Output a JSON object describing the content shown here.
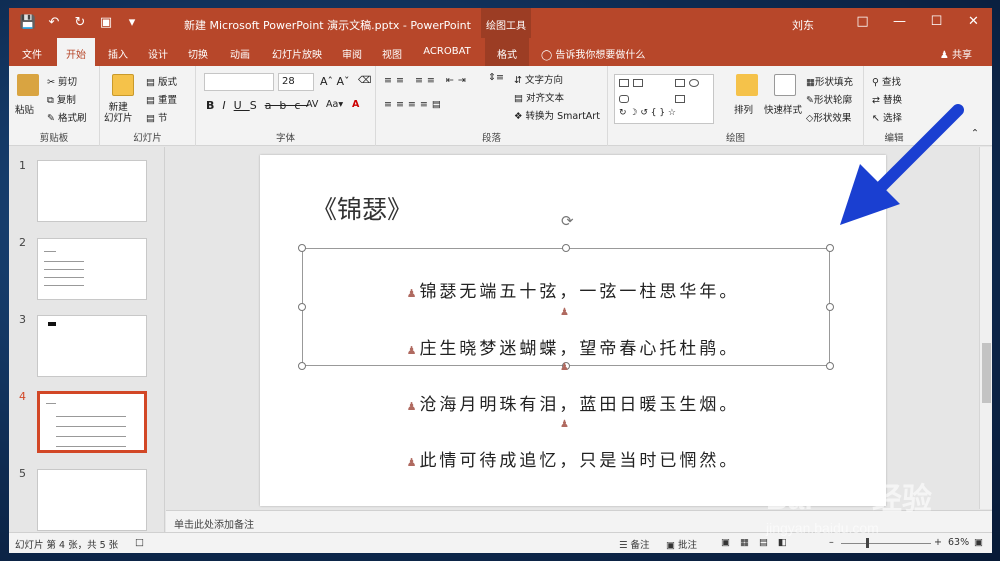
{
  "titlebar": {
    "doc_title": "新建 Microsoft PowerPoint 演示文稿.pptx  -  PowerPoint",
    "tool_tab": "绘图工具",
    "user": "刘东"
  },
  "tabs": [
    "文件",
    "开始",
    "插入",
    "设计",
    "切换",
    "动画",
    "幻灯片放映",
    "审阅",
    "视图",
    "ACROBAT",
    "格式"
  ],
  "active_tab": "开始",
  "tellme": "告诉我你想要做什么",
  "share": "共享",
  "ribbon": {
    "clipboard": {
      "paste": "粘贴",
      "cut": "剪切",
      "copy": "复制",
      "format_painter": "格式刷",
      "label": "剪贴板"
    },
    "slides": {
      "new_slide": "新建\n幻灯片",
      "layout": "版式",
      "reset": "重置",
      "section": "节",
      "label": "幻灯片"
    },
    "font": {
      "font_size": "28",
      "label": "字体"
    },
    "paragraph": {
      "text_direction": "文字方向",
      "align_text": "对齐文本",
      "smartart": "转换为 SmartArt",
      "label": "段落"
    },
    "drawing": {
      "arrange": "排列",
      "quick_styles": "快速样式",
      "shape_fill": "形状填充",
      "shape_outline": "形状轮廓",
      "shape_effects": "形状效果",
      "label": "绘图"
    },
    "editing": {
      "find": "查找",
      "replace": "替换",
      "select": "选择",
      "label": "编辑"
    }
  },
  "thumbnails": [
    {
      "num": "1"
    },
    {
      "num": "2"
    },
    {
      "num": "3"
    },
    {
      "num": "4"
    },
    {
      "num": "5"
    }
  ],
  "slide": {
    "title": "《锦瑟》",
    "lines": [
      "锦瑟无端五十弦，一弦一柱思华年。",
      "庄生晓梦迷蝴蝶，望帝春心托杜鹃。",
      "沧海月明珠有泪，蓝田日暖玉生烟。",
      "此情可待成追忆，只是当时已惘然。"
    ]
  },
  "notes_placeholder": "单击此处添加备注",
  "status": {
    "slide_info": "幻灯片 第 4 张，共 5 张",
    "notes": "备注",
    "comments": "批注",
    "zoom": "63%"
  },
  "colors": {
    "accent": "#b7472a",
    "arrow": "#1a3fd1"
  }
}
